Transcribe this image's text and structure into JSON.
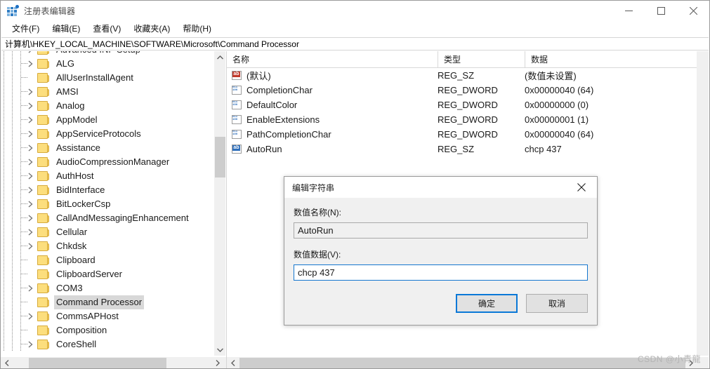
{
  "window": {
    "title": "注册表编辑器",
    "icon": "registry-icon",
    "controls": {
      "minimize": "minimize-icon",
      "maximize": "maximize-icon",
      "close": "close-icon"
    }
  },
  "menubar": {
    "items": [
      {
        "label": "文件(F)"
      },
      {
        "label": "编辑(E)"
      },
      {
        "label": "查看(V)"
      },
      {
        "label": "收藏夹(A)"
      },
      {
        "label": "帮助(H)"
      }
    ]
  },
  "address": {
    "path": "计算机\\HKEY_LOCAL_MACHINE\\SOFTWARE\\Microsoft\\Command Processor"
  },
  "tree": {
    "items": [
      {
        "label": "Advanced INF Setup",
        "expandable": true,
        "selected": false
      },
      {
        "label": "ALG",
        "expandable": true,
        "selected": false
      },
      {
        "label": "AllUserInstallAgent",
        "expandable": false,
        "selected": false
      },
      {
        "label": "AMSI",
        "expandable": true,
        "selected": false
      },
      {
        "label": "Analog",
        "expandable": true,
        "selected": false
      },
      {
        "label": "AppModel",
        "expandable": true,
        "selected": false
      },
      {
        "label": "AppServiceProtocols",
        "expandable": true,
        "selected": false
      },
      {
        "label": "Assistance",
        "expandable": true,
        "selected": false
      },
      {
        "label": "AudioCompressionManager",
        "expandable": true,
        "selected": false
      },
      {
        "label": "AuthHost",
        "expandable": true,
        "selected": false
      },
      {
        "label": "BidInterface",
        "expandable": true,
        "selected": false
      },
      {
        "label": "BitLockerCsp",
        "expandable": true,
        "selected": false
      },
      {
        "label": "CallAndMessagingEnhancement",
        "expandable": true,
        "selected": false
      },
      {
        "label": "Cellular",
        "expandable": true,
        "selected": false
      },
      {
        "label": "Chkdsk",
        "expandable": true,
        "selected": false
      },
      {
        "label": "Clipboard",
        "expandable": false,
        "selected": false
      },
      {
        "label": "ClipboardServer",
        "expandable": false,
        "selected": false
      },
      {
        "label": "COM3",
        "expandable": true,
        "selected": false
      },
      {
        "label": "Command Processor",
        "expandable": false,
        "selected": true
      },
      {
        "label": "CommsAPHost",
        "expandable": true,
        "selected": false
      },
      {
        "label": "Composition",
        "expandable": false,
        "selected": false
      },
      {
        "label": "CoreShell",
        "expandable": true,
        "selected": false
      }
    ]
  },
  "list": {
    "columns": [
      {
        "label": "名称"
      },
      {
        "label": "类型"
      },
      {
        "label": "数据"
      }
    ],
    "rows": [
      {
        "icon": "string-value-default-icon",
        "icon_kind": "sz-red",
        "name": "(默认)",
        "type": "REG_SZ",
        "data": "(数值未设置)"
      },
      {
        "icon": "dword-value-icon",
        "icon_kind": "dword",
        "name": "CompletionChar",
        "type": "REG_DWORD",
        "data": "0x00000040 (64)"
      },
      {
        "icon": "dword-value-icon",
        "icon_kind": "dword",
        "name": "DefaultColor",
        "type": "REG_DWORD",
        "data": "0x00000000 (0)"
      },
      {
        "icon": "dword-value-icon",
        "icon_kind": "dword",
        "name": "EnableExtensions",
        "type": "REG_DWORD",
        "data": "0x00000001 (1)"
      },
      {
        "icon": "dword-value-icon",
        "icon_kind": "dword",
        "name": "PathCompletionChar",
        "type": "REG_DWORD",
        "data": "0x00000040 (64)"
      },
      {
        "icon": "string-value-icon",
        "icon_kind": "sz-blue",
        "name": "AutoRun",
        "type": "REG_SZ",
        "data": "chcp 437"
      }
    ]
  },
  "dialog": {
    "title": "编辑字符串",
    "close_icon": "close-icon",
    "name_label": "数值名称(N):",
    "name_value": "AutoRun",
    "data_label": "数值数据(V):",
    "data_value": "chcp 437",
    "ok_label": "确定",
    "cancel_label": "取消"
  },
  "watermark": {
    "text": "CSDN @小青龍"
  },
  "colors": {
    "accent": "#0a78d7",
    "folder": "#fcde7d",
    "selection": "#d8d8d8"
  }
}
